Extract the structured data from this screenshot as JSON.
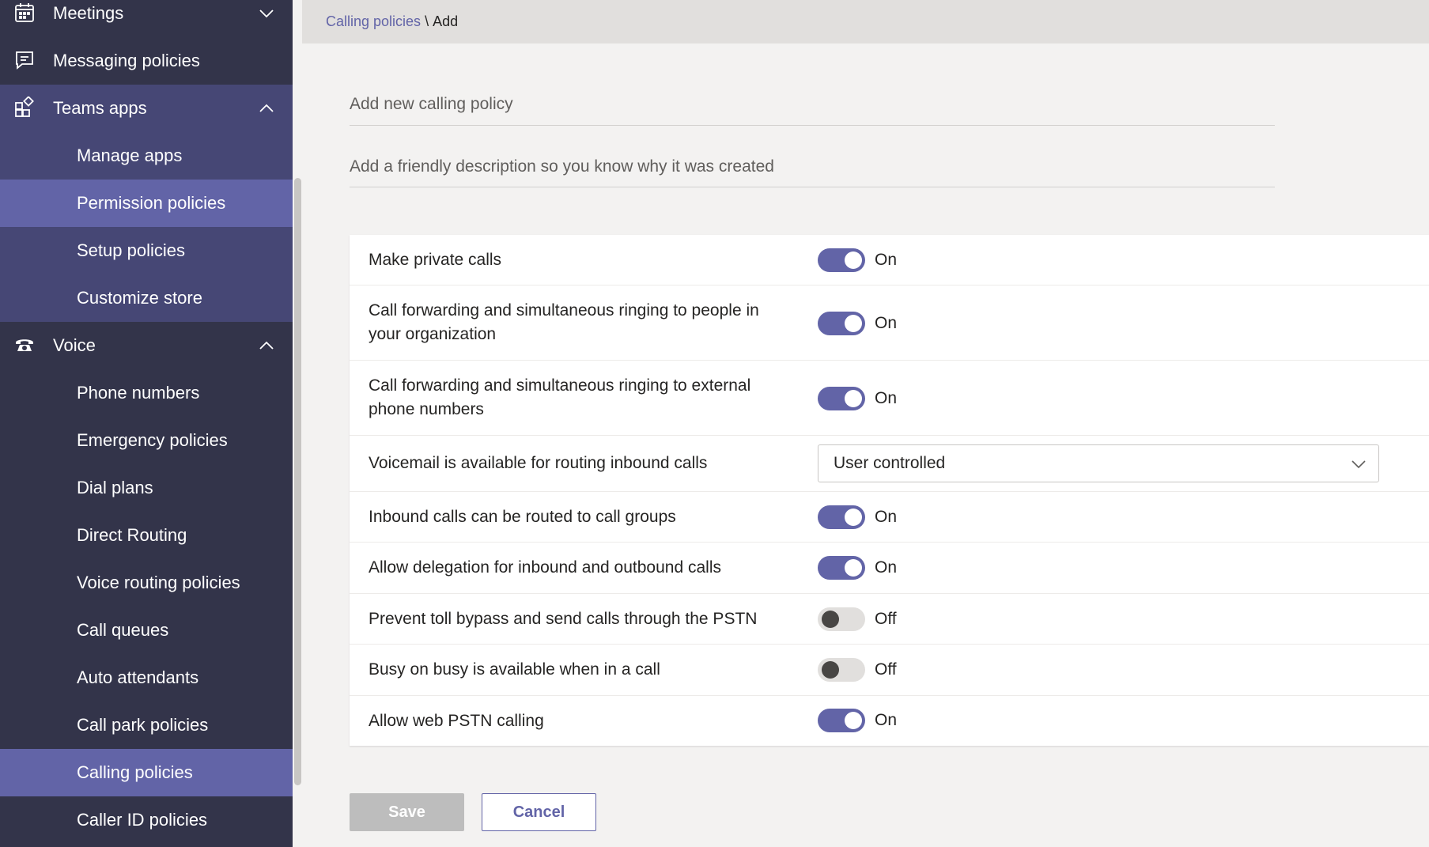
{
  "sidebar": {
    "items": [
      {
        "label": "Meetings"
      },
      {
        "label": "Messaging policies"
      },
      {
        "label": "Teams apps"
      },
      {
        "label": "Manage apps"
      },
      {
        "label": "Permission policies"
      },
      {
        "label": "Setup policies"
      },
      {
        "label": "Customize store"
      },
      {
        "label": "Voice"
      },
      {
        "label": "Phone numbers"
      },
      {
        "label": "Emergency policies"
      },
      {
        "label": "Dial plans"
      },
      {
        "label": "Direct Routing"
      },
      {
        "label": "Voice routing policies"
      },
      {
        "label": "Call queues"
      },
      {
        "label": "Auto attendants"
      },
      {
        "label": "Call park policies"
      },
      {
        "label": "Calling policies"
      },
      {
        "label": "Caller ID policies"
      }
    ]
  },
  "breadcrumb": {
    "parent": "Calling policies",
    "separator": "\\",
    "current": "Add"
  },
  "form": {
    "name_placeholder": "Add new calling policy",
    "description_placeholder": "Add a friendly description so you know why it was created"
  },
  "settings": [
    {
      "label": "Make private calls",
      "state": "On"
    },
    {
      "label": "Call forwarding and simultaneous ringing to people in your organization",
      "state": "On"
    },
    {
      "label": "Call forwarding and simultaneous ringing to external phone numbers",
      "state": "On"
    },
    {
      "label": "Voicemail is available for routing inbound calls",
      "value": "User controlled"
    },
    {
      "label": "Inbound calls can be routed to call groups",
      "state": "On"
    },
    {
      "label": "Allow delegation for inbound and outbound calls",
      "state": "On"
    },
    {
      "label": "Prevent toll bypass and send calls through the PSTN",
      "state": "Off"
    },
    {
      "label": "Busy on busy is available when in a call",
      "state": "Off"
    },
    {
      "label": "Allow web PSTN calling",
      "state": "On"
    }
  ],
  "buttons": {
    "save": "Save",
    "cancel": "Cancel"
  },
  "colors": {
    "sidebar_bg": "#33344a",
    "sidebar_group_bg": "#464775",
    "sidebar_selected_bg": "#6264a7",
    "accent": "#6264a7",
    "toggle_off": "#e1dfdd"
  }
}
